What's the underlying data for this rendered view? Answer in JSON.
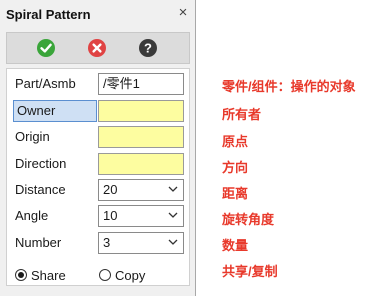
{
  "panel": {
    "title": "Spiral Pattern",
    "close_glyph": "×",
    "actions": [
      {
        "icon": "checkmark-circle-green-icon",
        "color": "#3aa53a"
      },
      {
        "icon": "cancel-circle-red-icon",
        "color": "#e04343"
      },
      {
        "icon": "help-circle-dark-icon",
        "color": "#3a3a3a"
      }
    ]
  },
  "form": {
    "part_label": "Part/Asmb",
    "part_value": "/零件1",
    "owner_label": "Owner",
    "owner_value": "",
    "origin_label": "Origin",
    "origin_value": "",
    "direction_label": "Direction",
    "direction_value": "",
    "distance_label": "Distance",
    "distance_value": "20",
    "angle_label": "Angle",
    "angle_value": "10",
    "number_label": "Number",
    "number_value": "3",
    "share_label": "Share",
    "copy_label": "Copy",
    "selected_mode": "Share"
  },
  "annotations": {
    "part": "零件/组件：操作的对象",
    "owner": "所有者",
    "origin": "原点",
    "direction": "方向",
    "distance": "距离",
    "angle": "旋转角度",
    "number": "数量",
    "mode": "共享/复制"
  },
  "colors": {
    "highlight_field": "#fdfda0",
    "selected_label": "#cfe0f4",
    "annotation_text": "#e8392b"
  }
}
